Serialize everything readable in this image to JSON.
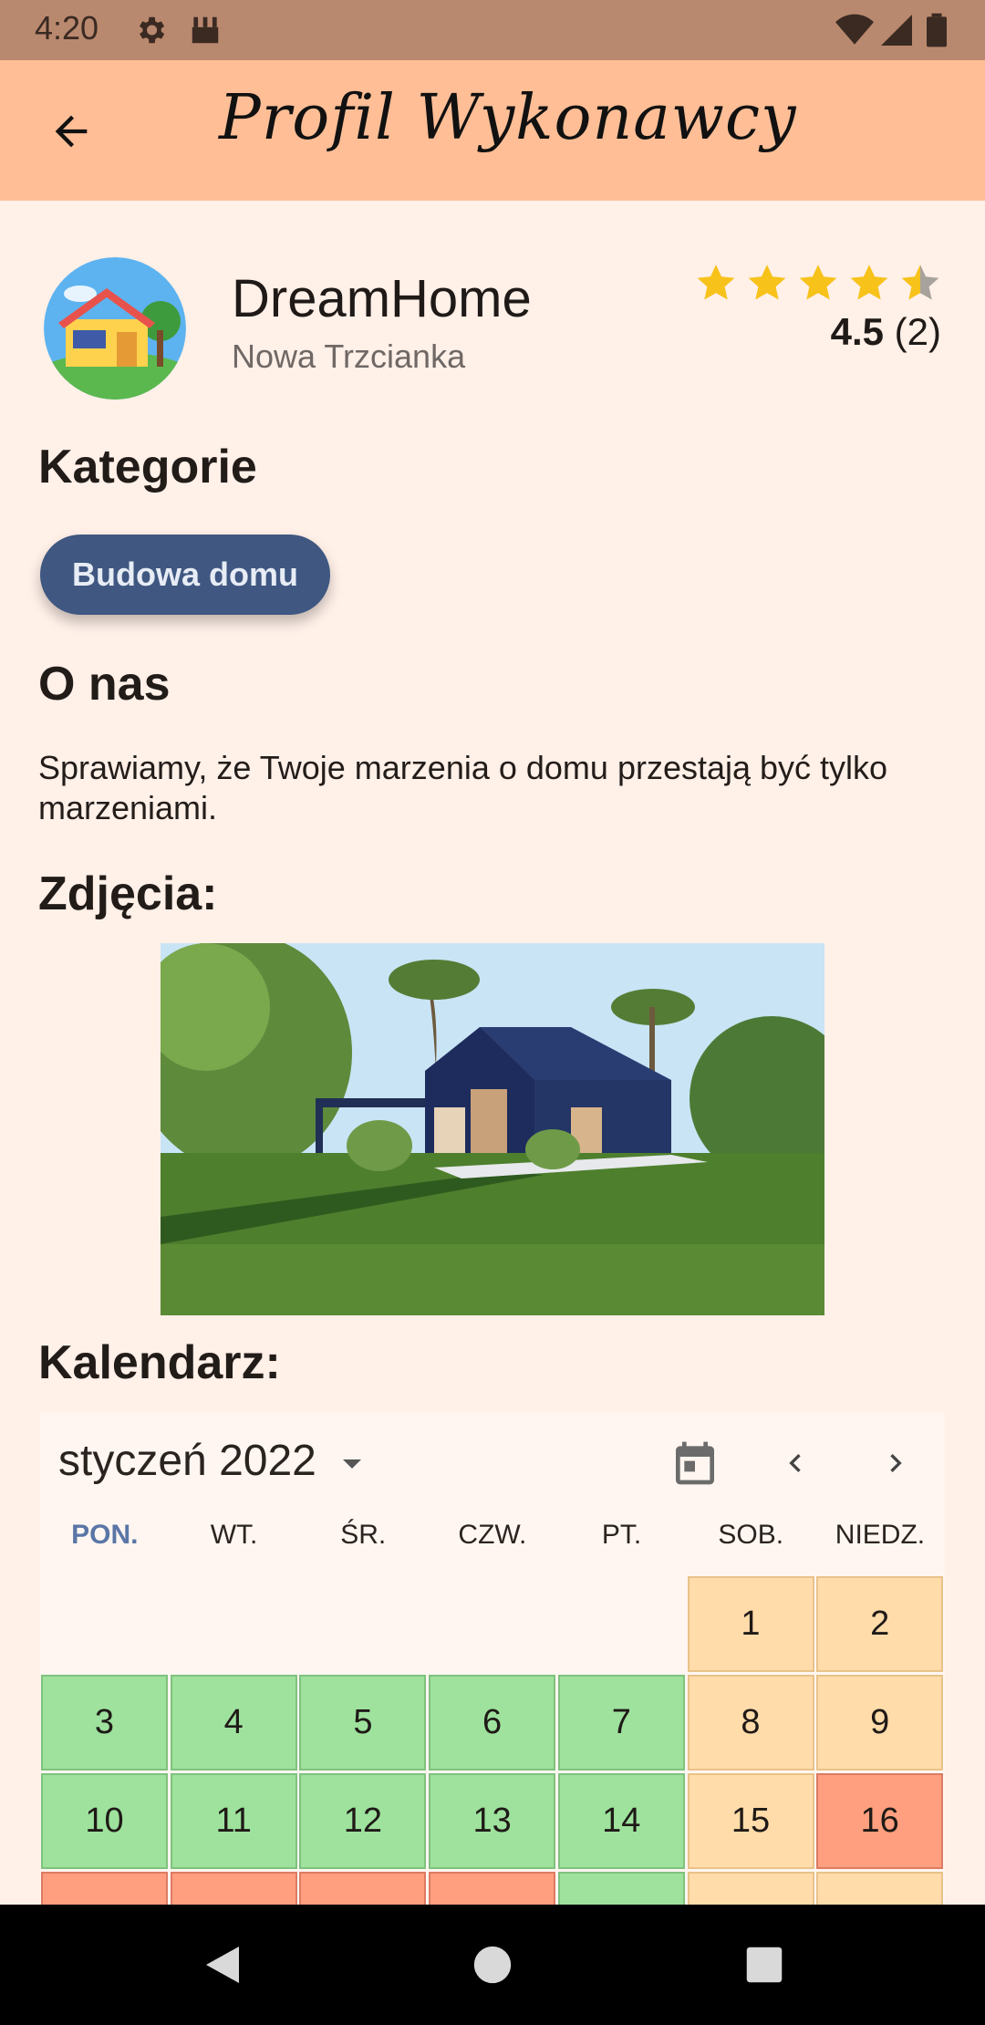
{
  "status_bar": {
    "time": "4:20"
  },
  "app_bar": {
    "title": "Profil Wykonawcy"
  },
  "profile": {
    "name": "DreamHome",
    "city": "Nowa Trzcianka",
    "rating_value": "4.5",
    "rating_count": "(2)",
    "stars_filled": 4.5,
    "stars_total": 5
  },
  "sections": {
    "categories_title": "Kategorie",
    "about_title": "O nas",
    "photos_title": "Zdjęcia:",
    "calendar_title": "Kalendarz:"
  },
  "categories": [
    {
      "label": "Budowa domu"
    }
  ],
  "about": {
    "text": "Sprawiamy, że Twoje marzenia o domu przestają być tylko marzeniami."
  },
  "calendar": {
    "month_label": "styczeń 2022",
    "weekdays": [
      "PON.",
      "WT.",
      "ŚR.",
      "CZW.",
      "PT.",
      "SOB.",
      "NIEDZ."
    ],
    "active_weekday": 0,
    "weeks": [
      [
        null,
        null,
        null,
        null,
        null,
        {
          "day": "1",
          "state": "sand"
        },
        {
          "day": "2",
          "state": "sand"
        }
      ],
      [
        {
          "day": "3",
          "state": "green"
        },
        {
          "day": "4",
          "state": "green"
        },
        {
          "day": "5",
          "state": "green"
        },
        {
          "day": "6",
          "state": "green"
        },
        {
          "day": "7",
          "state": "green"
        },
        {
          "day": "8",
          "state": "sand"
        },
        {
          "day": "9",
          "state": "sand"
        }
      ],
      [
        {
          "day": "10",
          "state": "green"
        },
        {
          "day": "11",
          "state": "green"
        },
        {
          "day": "12",
          "state": "green"
        },
        {
          "day": "13",
          "state": "green"
        },
        {
          "day": "14",
          "state": "green"
        },
        {
          "day": "15",
          "state": "sand"
        },
        {
          "day": "16",
          "state": "red"
        }
      ],
      [
        {
          "day": "",
          "state": "red"
        },
        {
          "day": "",
          "state": "red"
        },
        {
          "day": "",
          "state": "red"
        },
        {
          "day": "",
          "state": "red"
        },
        {
          "day": "",
          "state": "green"
        },
        {
          "day": "",
          "state": "sand"
        },
        {
          "day": "",
          "state": "sand"
        }
      ]
    ]
  },
  "colors": {
    "app_bar": "#ffbe96",
    "status_bar": "#b9896f",
    "background": "#fff0e8",
    "chip": "#3f5781",
    "star": "#f7c21a",
    "available": "#9ee29d",
    "weekend": "#ffdcaa",
    "busy": "#ff9f7f"
  },
  "icons": {
    "back": "arrow-left-icon",
    "calendar": "calendar-icon",
    "prev": "chevron-left-icon",
    "next": "chevron-right-icon"
  }
}
